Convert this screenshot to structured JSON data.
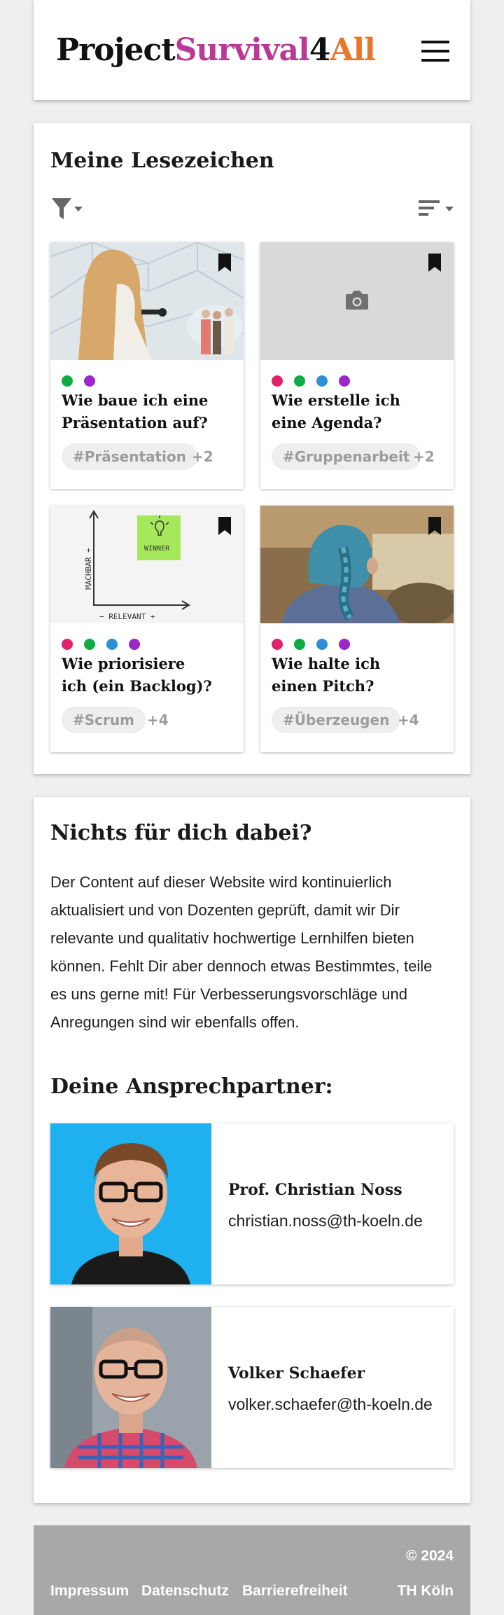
{
  "header": {
    "logo": {
      "part1": "Project",
      "part2": "Survival",
      "part3": "4",
      "part4": "All"
    },
    "menu_icon": "hamburger-menu-icon"
  },
  "bookmarks": {
    "title": "Meine Lesezeichen",
    "filter_icon": "filter-icon",
    "sort_icon": "sort-icon",
    "cards": [
      {
        "title_lines": [
          "Wie baue ich eine",
          "Präsentation auf?"
        ],
        "tag": "#Präsentation",
        "more": "+2",
        "dots": [
          "#11aa44",
          "#9b27c9"
        ],
        "image": "photo-speaker"
      },
      {
        "title_lines": [
          "Wie erstelle ich",
          "eine Agenda?"
        ],
        "tag": "#Gruppenarbeit",
        "more": "+2",
        "dots": [
          "#e0226b",
          "#11aa44",
          "#2e8fd6",
          "#9b27c9"
        ],
        "image": "camera-placeholder"
      },
      {
        "title_lines": [
          "Wie priorisiere",
          "ich (ein Backlog)?"
        ],
        "tag": "#Scrum",
        "more": "+4",
        "dots": [
          "#e0226b",
          "#11aa44",
          "#2e8fd6",
          "#9b27c9"
        ],
        "image": "sketch-chart",
        "sketch": {
          "y_label": "MACHBAR +",
          "x_label": "− RELEVANT +",
          "note": "WINNER"
        }
      },
      {
        "title_lines": [
          "Wie halte ich",
          "einen Pitch?"
        ],
        "tag": "#Überzeugen",
        "more": "+4",
        "dots": [
          "#e0226b",
          "#11aa44",
          "#2e8fd6",
          "#9b27c9"
        ],
        "image": "photo-blue-hair"
      }
    ]
  },
  "info": {
    "title": "Nichts für dich dabei?",
    "text_lines": [
      "Der Content auf dieser Website wird kontinuierlich",
      "aktualisiert und von Dozenten geprüft, damit wir Dir",
      "relevante und qualitativ hochwertige Lernhilfen bieten",
      "können. Fehlt Dir aber dennoch etwas Bestimmtes, teile",
      "es uns gerne mit! Für Verbesserungsvorschläge und",
      "Anregungen sind wir ebenfalls offen."
    ],
    "contacts_title": "Deine Ansprechpartner:",
    "contacts": [
      {
        "name": "Prof. Christian Noss",
        "email": "christian.noss@th-koeln.de"
      },
      {
        "name": "Volker Schaefer",
        "email": "volker.schaefer@th-koeln.de"
      }
    ]
  },
  "footer": {
    "links": [
      "Impressum",
      "Datenschutz",
      "Barrierefreiheit"
    ],
    "copyright": "© 2024",
    "org": "TH Köln"
  },
  "colors": {
    "brand_pink": "#b83a96",
    "brand_orange": "#e8772e",
    "footer_bg": "#a8a8a8"
  }
}
